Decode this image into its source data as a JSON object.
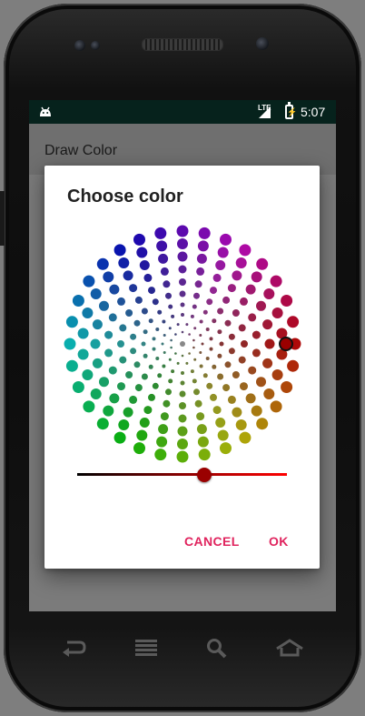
{
  "statusbar": {
    "network": "LTE",
    "time": "5:07"
  },
  "appbar": {
    "title": "Draw Color"
  },
  "dialog": {
    "title": "Choose color",
    "cancel_label": "CANCEL",
    "ok_label": "OK",
    "brightness": {
      "value": 0.6,
      "track_colors": [
        "#000000",
        "#ff0000"
      ]
    },
    "selected_color": "#9a0000",
    "wheel": {
      "type": "dot-color-wheel"
    }
  },
  "navbar": {
    "icons": [
      "back-icon",
      "menu-icon",
      "search-icon",
      "home-icon"
    ]
  }
}
